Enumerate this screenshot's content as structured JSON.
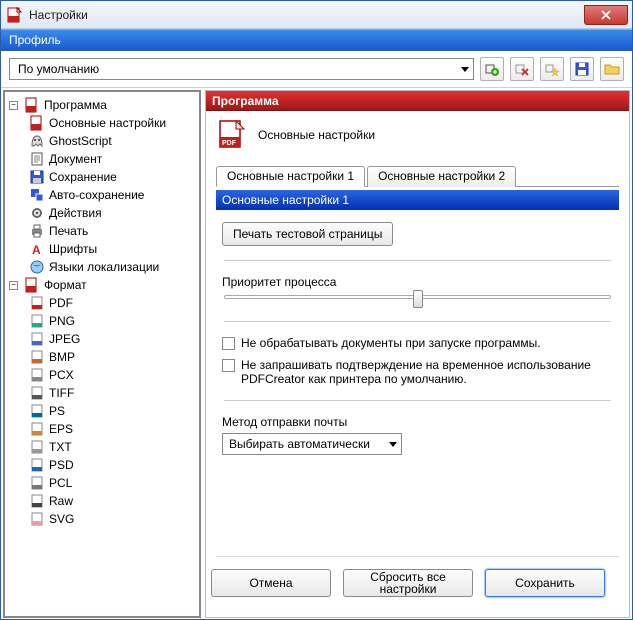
{
  "window": {
    "title": "Настройки"
  },
  "profile": {
    "bar_label": "Профиль",
    "selected": "По умолчанию"
  },
  "tree": {
    "section1_label": "Программа",
    "section1_items": [
      "Основные настройки",
      "GhostScript",
      "Документ",
      "Сохранение",
      "Авто-сохранение",
      "Действия",
      "Печать",
      "Шрифты",
      "Языки локализации"
    ],
    "section2_label": "Формат",
    "section2_items": [
      "PDF",
      "PNG",
      "JPEG",
      "BMP",
      "PCX",
      "TIFF",
      "PS",
      "EPS",
      "TXT",
      "PSD",
      "PCL",
      "Raw",
      "SVG"
    ]
  },
  "content": {
    "section_title": "Программа",
    "header_label": "Основные настройки",
    "tab1": "Основные настройки 1",
    "tab2": "Основные настройки 2",
    "subheader": "Основные настройки 1",
    "test_print_btn": "Печать тестовой страницы",
    "priority_label": "Приоритет процесса",
    "slider_value": 0.5,
    "check1": "Не обрабатывать документы при запуске программы.",
    "check2": "Не запрашивать подтверждение на временное использование PDFCreator как принтера по умолчанию.",
    "mail_label": "Метод отправки почты",
    "mail_selected": "Выбирать автоматически"
  },
  "footer": {
    "cancel": "Отмена",
    "reset": "Сбросить все настройки",
    "save": "Сохранить"
  }
}
